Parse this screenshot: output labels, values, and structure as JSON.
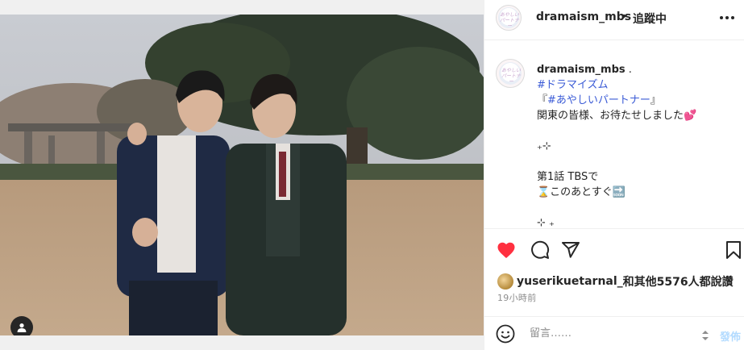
{
  "post": {
    "author": "dramaism_mbs",
    "header_separator": "•",
    "follow_status": "追蹤中",
    "avatar_logo": "あやしい パートナー"
  },
  "caption": {
    "author": "dramaism_mbs",
    "author_suffix": " .",
    "hashtag1": "#ドラマイズム",
    "line2_prefix": "『",
    "hashtag2": "#あやしいパートナー",
    "line2_suffix": "』",
    "line3": "関東の皆様、お待たせしました💕",
    "sparkle1": "₊⊹",
    "line5": "第1話 TBSで",
    "line6": "⌛このあとすぐ🔜",
    "sparkle2": "⊹ ₊"
  },
  "likes": {
    "text_user": "yuserikuetarnal_",
    "text_rest": "和其他5576人都說讚"
  },
  "timestamp": "19小時前",
  "comment": {
    "placeholder": "留言……",
    "post_label": "發佈"
  },
  "icons": {
    "more": "more-horizontal-icon",
    "like": "heart-icon",
    "comment": "comment-icon",
    "share": "share-icon",
    "save": "bookmark-icon",
    "emoji": "emoji-icon",
    "tag": "user-tag-icon"
  },
  "colors": {
    "like_red": "#ff3040",
    "hashtag_blue": "#3b5bd6",
    "post_disabled": "#b3dbff",
    "secondary_text": "#8e8e8e"
  }
}
